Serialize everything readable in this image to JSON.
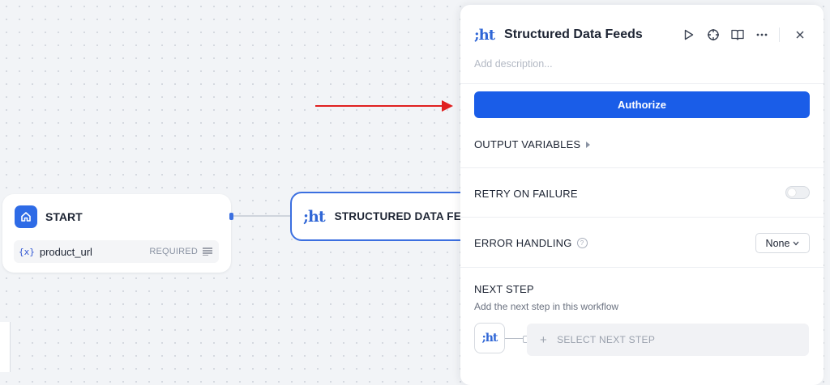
{
  "canvas": {
    "start_node": {
      "title": "START",
      "variable": {
        "icon_text": "{x}",
        "name": "product_url",
        "badge": "REQUIRED"
      }
    },
    "structured_node": {
      "logo_text": ";ht",
      "label": "STRUCTURED DATA FEEDS"
    }
  },
  "panel": {
    "logo_text": ";ht",
    "title": "Structured Data Feeds",
    "description_placeholder": "Add description...",
    "authorize_label": "Authorize",
    "output_variables_label": "OUTPUT VARIABLES",
    "retry_label": "RETRY ON FAILURE",
    "retry_enabled": false,
    "error_handling_label": "ERROR HANDLING",
    "error_handling_value": "None",
    "next_step_label": "NEXT STEP",
    "next_step_sub": "Add the next step in this workflow",
    "select_next_label": "SELECT NEXT STEP",
    "icons": [
      "play-icon",
      "crosshair-icon",
      "book-icon",
      "more-icon",
      "close-icon"
    ]
  },
  "colors": {
    "accent": "#1a5de8",
    "annotation": "#e02020"
  }
}
